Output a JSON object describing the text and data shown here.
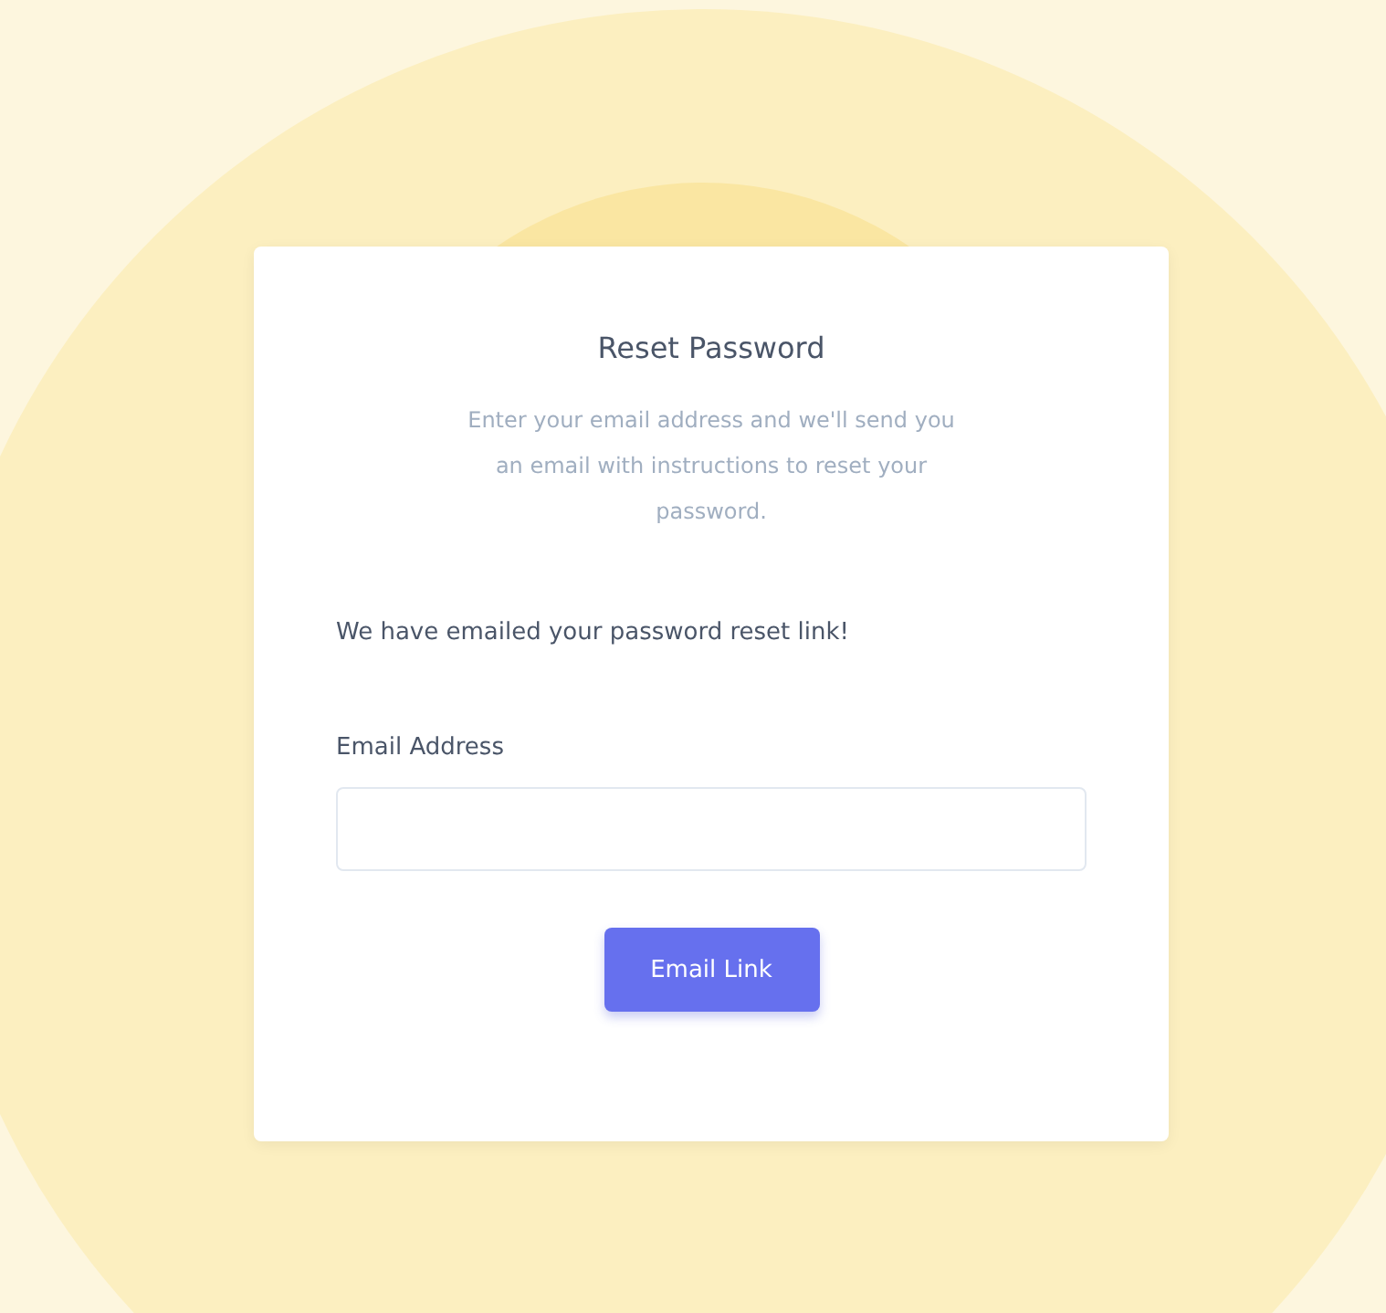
{
  "card": {
    "title": "Reset Password",
    "subtitle": "Enter your email address and we'll send you an email with instructions to reset your password.",
    "status_message": "We have emailed your password reset link!",
    "email_field": {
      "label": "Email Address"
    },
    "button": "Email Link"
  }
}
